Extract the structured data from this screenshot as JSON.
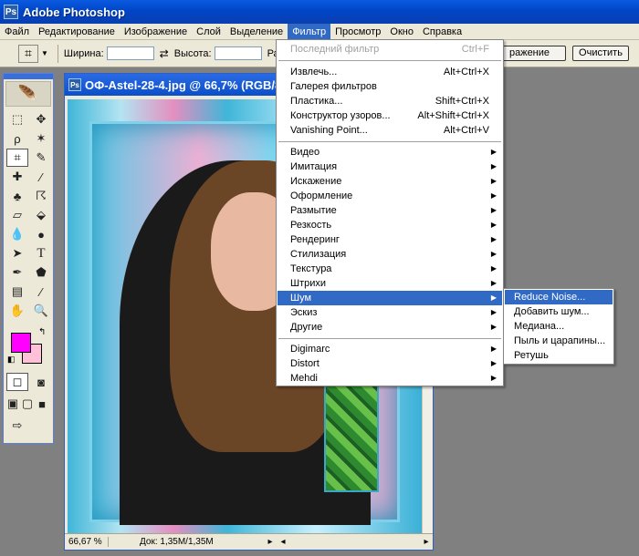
{
  "app": {
    "title": "Adobe Photoshop",
    "logo_text": "Ps"
  },
  "menubar": {
    "items": [
      "Файл",
      "Редактирование",
      "Изображение",
      "Слой",
      "Выделение",
      "Фильтр",
      "Просмотр",
      "Окно",
      "Справка"
    ],
    "active": "Фильтр"
  },
  "options": {
    "width_label": "Ширина:",
    "height_label": "Высота:",
    "res_label_partial": "Ра",
    "image_button": "ражение",
    "clear_button": "Очистить"
  },
  "document": {
    "title": "ОФ-Astel-28-4.jpg @ 66,7% (RGB/8/...",
    "zoom": "66,67 %",
    "doc_size": "Док: 1,35M/1,35M"
  },
  "filter_menu": {
    "items": [
      {
        "label": "Последний фильтр",
        "shortcut": "Ctrl+F",
        "disabled": true
      },
      {
        "label": "Извлечь...",
        "shortcut": "Alt+Ctrl+X"
      },
      {
        "label": "Галерея фильтров",
        "shortcut": ""
      },
      {
        "label": "Пластика...",
        "shortcut": "Shift+Ctrl+X"
      },
      {
        "label": "Конструктор узоров...",
        "shortcut": "Alt+Shift+Ctrl+X"
      },
      {
        "label": "Vanishing Point...",
        "shortcut": "Alt+Ctrl+V"
      },
      {
        "label": "Видео",
        "submenu": true
      },
      {
        "label": "Имитация",
        "submenu": true
      },
      {
        "label": "Искажение",
        "submenu": true
      },
      {
        "label": "Оформление",
        "submenu": true
      },
      {
        "label": "Размытие",
        "submenu": true
      },
      {
        "label": "Резкость",
        "submenu": true
      },
      {
        "label": "Рендеринг",
        "submenu": true
      },
      {
        "label": "Стилизация",
        "submenu": true
      },
      {
        "label": "Текстура",
        "submenu": true
      },
      {
        "label": "Штрихи",
        "submenu": true
      },
      {
        "label": "Шум",
        "submenu": true,
        "highlighted": true
      },
      {
        "label": "Эскиз",
        "submenu": true
      },
      {
        "label": "Другие",
        "submenu": true
      },
      {
        "label": "Digimarc",
        "submenu": true
      },
      {
        "label": "Distort",
        "submenu": true
      },
      {
        "label": "Mehdi",
        "submenu": true
      }
    ]
  },
  "noise_submenu": {
    "items": [
      {
        "label": "Reduce Noise...",
        "highlighted": true
      },
      {
        "label": "Добавить шум..."
      },
      {
        "label": "Медиана..."
      },
      {
        "label": "Пыль и царапины..."
      },
      {
        "label": "Ретушь"
      }
    ]
  },
  "colors": {
    "foreground": "#ff00ff",
    "background": "#ffc0d8",
    "menu_highlight": "#316ac5"
  },
  "toolbox": {
    "icons": [
      "marquee-icon",
      "move-icon",
      "lasso-icon",
      "magic-wand-icon",
      "crop-icon",
      "slice-icon",
      "healing-brush-icon",
      "brush-icon",
      "clone-stamp-icon",
      "history-brush-icon",
      "eraser-icon",
      "paint-bucket-icon",
      "blur-icon",
      "dodge-icon",
      "path-selection-icon",
      "type-icon",
      "pen-icon",
      "shape-icon",
      "notes-icon",
      "eyedropper-icon",
      "hand-icon",
      "zoom-icon"
    ]
  }
}
